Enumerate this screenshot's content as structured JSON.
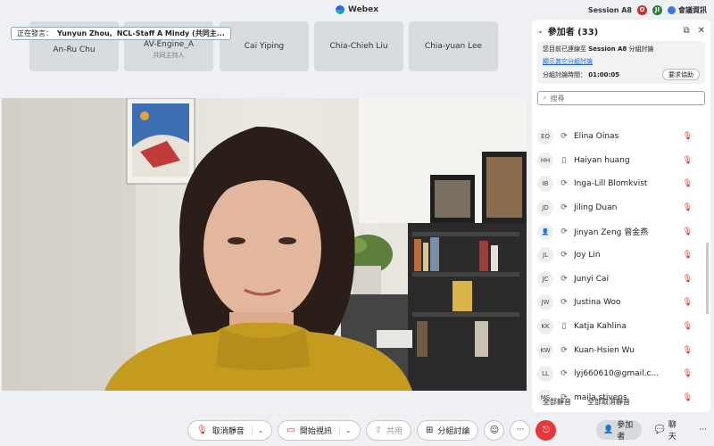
{
  "app": {
    "title": "Webex",
    "session": "Session A8",
    "avatar_1": "O",
    "avatar_2": "JI",
    "meeting_info": "會議資訊"
  },
  "speaking": {
    "label": "正在發言：",
    "speaker_1": "Yunyun Zhou,",
    "speaker_2": "NCL-Staff A Mindy (共同主..."
  },
  "tiles": [
    {
      "name": "An-Ru Chu",
      "sub": ""
    },
    {
      "name": "AV-Engine_A",
      "sub": "共同主持人"
    },
    {
      "name": "Cai Yiping",
      "sub": ""
    },
    {
      "name": "Chia-Chieh Liu",
      "sub": ""
    },
    {
      "name": "Chia-yuan Lee",
      "sub": ""
    }
  ],
  "panel": {
    "title": "參加者 (33)",
    "breakout_line1": "您目前已連線至",
    "breakout_session": "Session A8",
    "breakout_line1_end": "分組討論",
    "show_other": "顯示其它分組討論",
    "time_label": "分組討論時間：",
    "time_value": "01:00:05",
    "help_button": "要求協助",
    "search_placeholder": "搜尋",
    "mute_all": "全部靜音",
    "unmute_all": "全部取消靜音"
  },
  "participants": [
    {
      "initials": "EO",
      "device": "sync",
      "name": "Elina Oinas"
    },
    {
      "initials": "HH",
      "device": "phone",
      "name": "Haiyan huang"
    },
    {
      "initials": "IB",
      "device": "sync",
      "name": "Inga-Lill Blomkvist"
    },
    {
      "initials": "JD",
      "device": "sync",
      "name": "Jiling Duan"
    },
    {
      "initials": "",
      "device": "sync",
      "name": "Jinyan Zeng 曾金燕"
    },
    {
      "initials": "JL",
      "device": "sync",
      "name": "Joy Lin"
    },
    {
      "initials": "JC",
      "device": "sync",
      "name": "Junyi Cai"
    },
    {
      "initials": "JW",
      "device": "sync",
      "name": "Justina Woo"
    },
    {
      "initials": "KK",
      "device": "phone",
      "name": "Katja Kahlina"
    },
    {
      "initials": "KW",
      "device": "sync",
      "name": "Kuan-Hsien Wu"
    },
    {
      "initials": "LL",
      "device": "sync",
      "name": "lyj660610@gmail.c..."
    },
    {
      "initials": "MS",
      "device": "sync",
      "name": "maila stivens"
    }
  ],
  "controls": {
    "unmute": "取消靜音",
    "start_video": "開始視訊",
    "share": "共用",
    "breakout": "分組討論",
    "more": "···"
  },
  "right_tabs": {
    "participants": "參加者",
    "chat": "聊天",
    "more": "···"
  }
}
